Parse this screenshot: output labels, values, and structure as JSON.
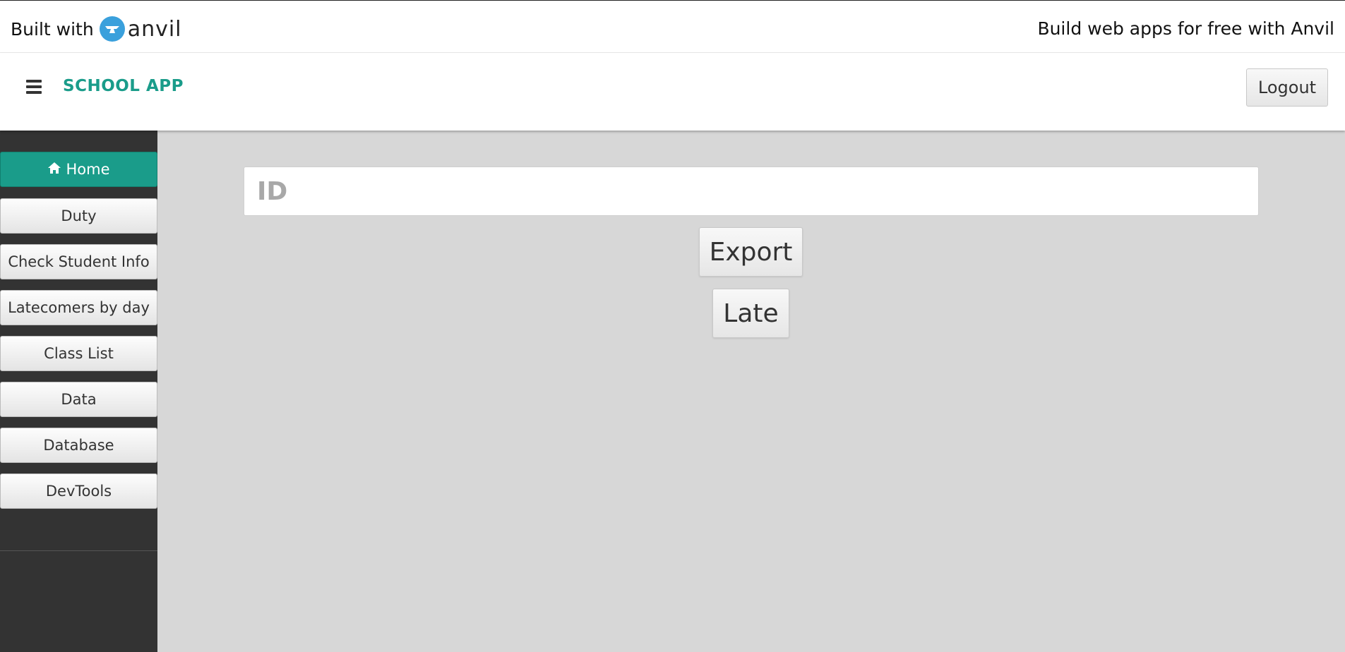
{
  "banner": {
    "built_with": "Built with",
    "logo_text": "anvil",
    "promo": "Build web apps for free with Anvil",
    "logo_color": "#3aa0dc"
  },
  "header": {
    "title": "SCHOOL APP",
    "logout_label": "Logout",
    "accent_color": "#1a9c8a"
  },
  "sidebar": {
    "items": [
      {
        "label": "Home",
        "icon": "home-icon",
        "active": true
      },
      {
        "label": "Duty"
      },
      {
        "label": "Check Student Info"
      },
      {
        "label": "Latecomers by day"
      },
      {
        "label": "Class List"
      },
      {
        "label": "Data"
      },
      {
        "label": "Database"
      },
      {
        "label": "DevTools"
      }
    ]
  },
  "main": {
    "id_placeholder": "ID",
    "export_label": "Export",
    "late_label": "Late"
  }
}
